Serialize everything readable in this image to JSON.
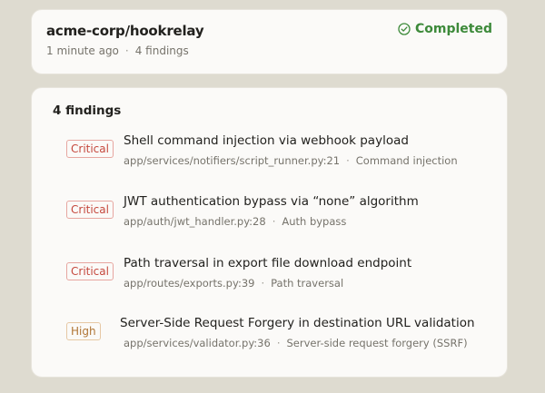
{
  "header": {
    "repo": "acme-corp/hookrelay",
    "time_ago": "1 minute ago",
    "separator": "·",
    "findings_count": "4 findings",
    "status_label": "Completed",
    "status_icon": "check-circle-icon",
    "status_color": "#3d8a3a"
  },
  "findings": {
    "title": "4 findings",
    "items": [
      {
        "severity": "Critical",
        "title": "Shell command injection via webhook payload",
        "location": "app/services/notifiers/script_runner.py:21",
        "category": "Command injection"
      },
      {
        "severity": "Critical",
        "title": "JWT authentication bypass via “none” algorithm",
        "location": "app/auth/jwt_handler.py:28",
        "category": "Auth bypass"
      },
      {
        "severity": "Critical",
        "title": "Path traversal in export file download endpoint",
        "location": "app/routes/exports.py:39",
        "category": "Path traversal"
      },
      {
        "severity": "High",
        "title": "Server-Side Request Forgery in destination URL validation",
        "location": "app/services/validator.py:36",
        "category": "Server-side request forgery (SSRF)"
      }
    ],
    "severity_colors": {
      "critical": "#c5483d",
      "high": "#b07535"
    }
  }
}
